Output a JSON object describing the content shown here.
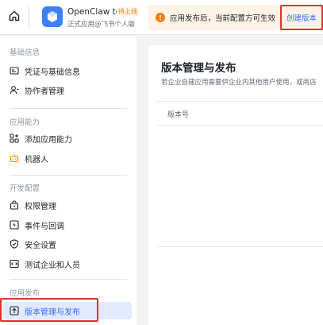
{
  "header": {
    "home_icon": "home-icon",
    "app": {
      "name": "OpenClaw test",
      "badge": "待上线",
      "subtitle": "正式应用@飞书个人版",
      "icon": "app-cube-icon",
      "icon_color": "#3d7ff6"
    },
    "notice": {
      "icon": "warning-icon",
      "text": "应用发布后，当前配置方可生效",
      "link": "创建版本"
    }
  },
  "sidebar": {
    "groups": [
      {
        "title": "基础信息",
        "items": [
          {
            "label": "凭证与基础信息",
            "icon": "credentials-icon"
          },
          {
            "label": "协作者管理",
            "icon": "collaborator-icon"
          }
        ]
      },
      {
        "title": "应用能力",
        "items": [
          {
            "label": "添加应用能力",
            "icon": "add-capability-icon"
          },
          {
            "label": "机器人",
            "icon": "bot-icon"
          }
        ]
      },
      {
        "title": "开发配置",
        "items": [
          {
            "label": "权限管理",
            "icon": "permission-icon"
          },
          {
            "label": "事件与回调",
            "icon": "event-callback-icon"
          },
          {
            "label": "安全设置",
            "icon": "security-icon"
          },
          {
            "label": "测试企业和人员",
            "icon": "test-enterprise-icon"
          }
        ]
      },
      {
        "title": "应用发布",
        "items": [
          {
            "label": "版本管理与发布",
            "icon": "version-release-icon",
            "active": true
          }
        ]
      }
    ]
  },
  "main": {
    "title": "版本管理与发布",
    "description": "若企业自建应用需要供企业内其他用户使用，或商店",
    "table": {
      "columns": [
        "版本号"
      ]
    }
  },
  "colors": {
    "accent": "#3370ff",
    "highlight_border": "#e0312f",
    "notice_bg": "#fff3e8",
    "active_bg": "#e1eaff"
  }
}
